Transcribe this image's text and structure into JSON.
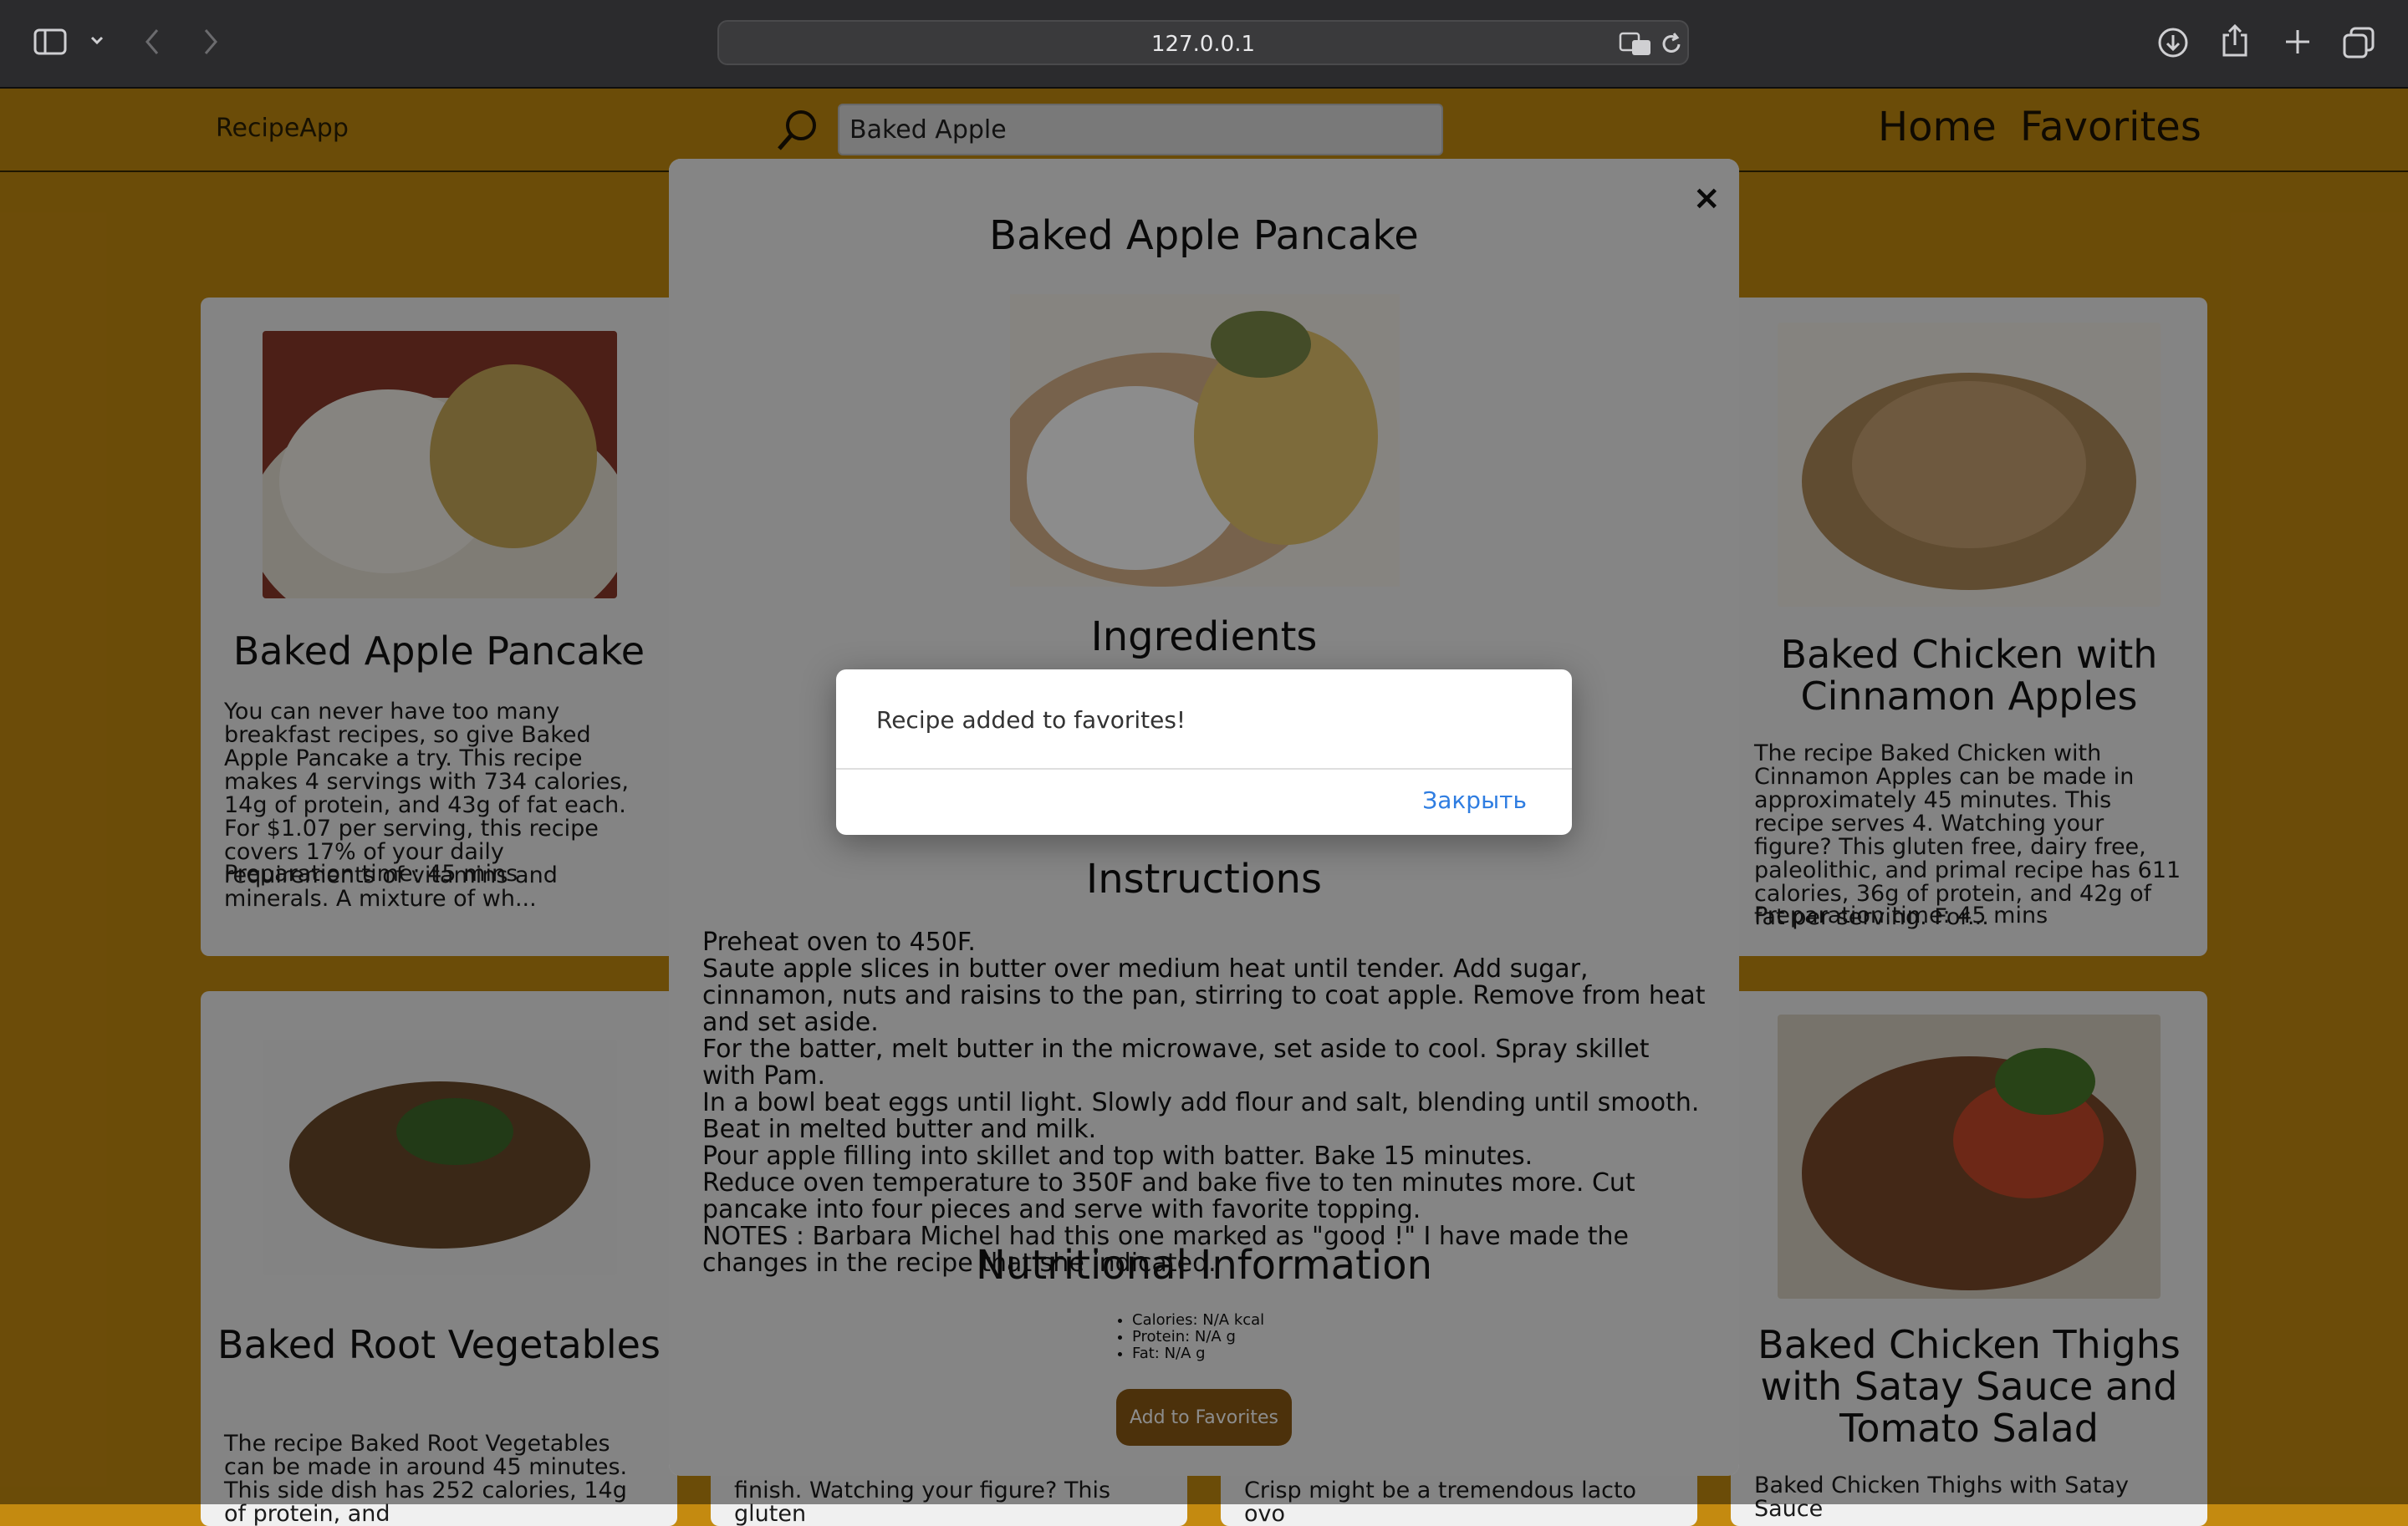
{
  "browser": {
    "url": "127.0.0.1"
  },
  "navbar": {
    "brand": "RecipeApp",
    "search_value": "Baked Apple",
    "links": [
      "Home",
      "Favorites"
    ]
  },
  "cards": [
    {
      "title": "Baked Apple Pancake",
      "desc": "You can never have too many breakfast recipes, so give Baked Apple Pancake a try. This recipe makes 4 servings with 734 calories, 14g of protein, and 43g of fat each. For $1.07 per serving, this recipe covers 17% of your daily requirements of vitamins and minerals. A mixture of wh...",
      "prep": "Preparation time: 45 mins"
    },
    {
      "title": "Baked Chicken with Cinnamon Apples",
      "desc": "The recipe Baked Chicken with Cinnamon Apples can be made in approximately 45 minutes. This recipe serves 4. Watching your figure? This gluten free, dairy free, paleolithic, and primal recipe has 611 calories, 36g of protein, and 42g of fat per serving. For...",
      "prep": "Preparation time: 45 mins"
    },
    {
      "title": "Baked Root Vegetables",
      "desc": "The recipe Baked Root Vegetables can be made in around 45 minutes. This side dish has 252 calories, 14g of protein, and"
    },
    {
      "title": "Baked Chicken Thighs with Satay Sauce and Tomato Salad",
      "desc": "Baked Chicken Thighs with Satay Sauce"
    }
  ],
  "partial_cards": {
    "middle_left_text": "finish. Watching your figure? This gluten",
    "middle_right_text": "Crisp might be a tremendous lacto ovo"
  },
  "modal": {
    "close_symbol": "×",
    "title": "Baked Apple Pancake",
    "ingredients_heading": "Ingredients",
    "instructions_heading": "Instructions",
    "instructions": [
      "Preheat oven to 450F.",
      "Saute apple slices in butter over medium heat until tender. Add sugar, cinnamon, nuts and raisins to the pan, stirring to coat apple. Remove from heat and set aside.",
      "For the batter, melt butter in the microwave, set aside to cool. Spray skillet with Pam.",
      "In a bowl beat eggs until light. Slowly add flour and salt, blending until smooth. Beat in melted butter and milk.",
      "Pour apple filling into skillet and top with batter. Bake 15 minutes.",
      "Reduce oven temperature to 350F and bake five to ten minutes more. Cut pancake into four pieces and serve with favorite topping.",
      "NOTES : Barbara Michel had this one marked as \"good !\" I have made the changes in the recipe that she indicated."
    ],
    "nutrition_heading": "Nutritional Information",
    "nutrition": [
      "Calories: N/A kcal",
      "Protein: N/A g",
      "Fat: N/A g"
    ],
    "add_button": "Add to Favorites"
  },
  "alert": {
    "message": "Recipe added to favorites!",
    "button": "Закрыть"
  },
  "colors": {
    "page_bg": "#c48a10",
    "button_bg": "#8b5a14",
    "alert_link": "#2f7de1"
  }
}
